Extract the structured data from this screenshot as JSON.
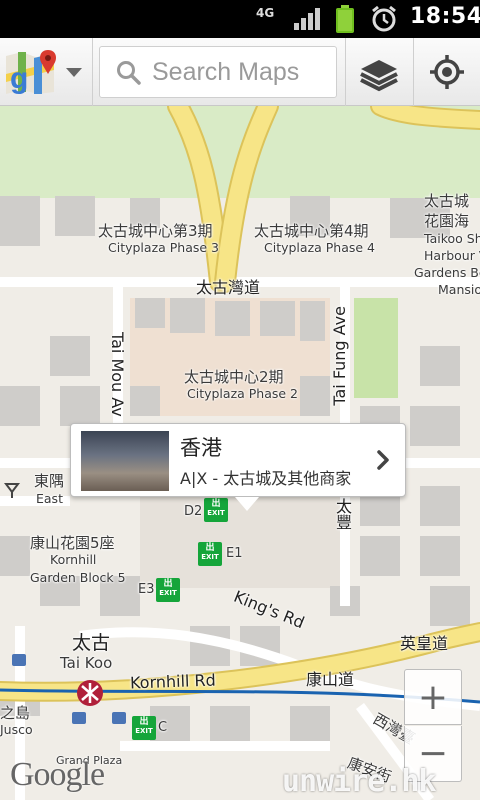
{
  "status_bar": {
    "network": "4G",
    "time": "18:54",
    "signal_icon": "signal-icon",
    "battery_icon": "battery-icon",
    "alarm_icon": "alarm-icon"
  },
  "action_bar": {
    "app_logo_icon": "google-maps-logo-icon",
    "search": {
      "placeholder": "Search Maps",
      "value": ""
    },
    "layers_icon": "layers-icon",
    "my_location_icon": "my-location-icon"
  },
  "map": {
    "labels": {
      "cityplaza3_cn": "太古城中心第3期",
      "cityplaza3_en": "Cityplaza Phase 3",
      "cityplaza4_cn": "太古城中心第4期",
      "cityplaza4_en": "Cityplaza Phase 4",
      "taikoo_shing_cn_1": "太古城",
      "taikoo_shing_cn_2": "花園海",
      "taikoo_shing_en_1": "Taikoo Sh",
      "taikoo_shing_en_2": "Harbour V",
      "taikoo_shing_en_3": "Gardens Be",
      "taikoo_shing_en_4": "Mansio",
      "taikoo_wan_road": "太古灣道",
      "tai_mou_ave": "Tai Mou Av",
      "tai_fung_ave": "Tai Fung Ave",
      "cityplaza2_cn": "太古城中心2期",
      "cityplaza2_en": "Cityplaza Phase 2",
      "east_cn": "東隅",
      "east_en": "East",
      "tai_fung_cn": "太豐",
      "kornhill_cn": "康山花園5座",
      "kornhill_en_1": "Kornhill",
      "kornhill_en_2": "Garden Block 5",
      "kings_road": "King's Rd",
      "kings_road_cn": "英皇道",
      "kornhill_road_cn": "康山道",
      "kornhill_road": "Kornhill Rd",
      "tai_koo_cn": "太古",
      "tai_koo_en": "Tai Koo",
      "island_cn": "之島",
      "jusco": "Jusco",
      "grand_plaza": "Grand Plaza",
      "sai_wan_cn": "西灣臺",
      "hong_on_cn": "康安街"
    },
    "exits": {
      "d2": "D2",
      "e1": "E1",
      "e3": "E3",
      "c": "C",
      "exit_text": "EXIT",
      "exit_cn": "出"
    },
    "info_bubble": {
      "title": "香港",
      "subtitle": "A|X - 太古城及其他商家",
      "thumbnail_icon": "street-photo-thumbnail",
      "chevron_icon": "chevron-right-icon"
    },
    "zoom": {
      "in_label": "+",
      "out_label": "−"
    },
    "attribution": "Google",
    "watermark": "unwire.hk"
  },
  "colors": {
    "road_major": "#f7e587",
    "road_major_edge": "#dcc35a",
    "mtr_line": "#1a63b0",
    "mtr_station": "#b0203a",
    "exit_green": "#15a53a",
    "park": "#c8e3a8"
  }
}
